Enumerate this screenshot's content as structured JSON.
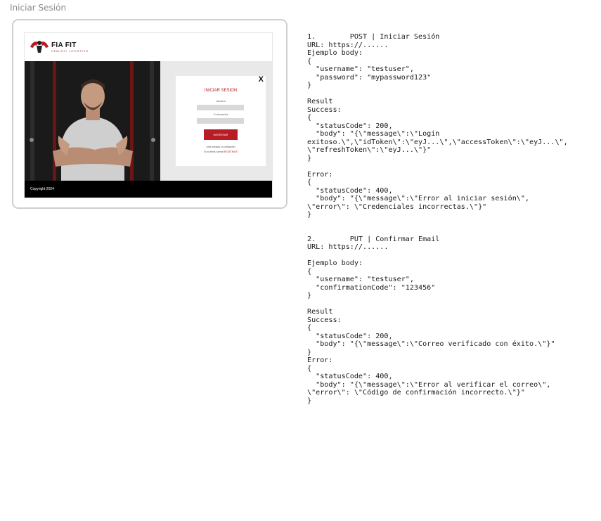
{
  "frame_title": "Iniciar Sesión",
  "mockup": {
    "logo_text": "FIA FIT",
    "logo_subtext": "HEALTHY LIFESTYLE",
    "close_label": "X",
    "card_title": "INICIAR SESION",
    "username_label": "Usuario",
    "password_label": "Contraseña",
    "submit_label": "INGRESAR",
    "forgot_text": "¿Has olvidado tu contraseña?",
    "signup_prefix": "Si no tienes cuenta",
    "signup_link": "REGISTRATE",
    "copyright": "Copyright 2024"
  },
  "doc_lines": [
    "1.        POST | Iniciar Sesión",
    "URL: https://......",
    "Ejemplo body:",
    "{",
    "  \"username\": \"testuser\",",
    "  \"password\": \"mypassword123\"",
    "}",
    "",
    "Result",
    "Success:",
    "{",
    "  \"statusCode\": 200,",
    "  \"body\": \"{\\\"message\\\":\\\"Login",
    "exitoso.\\\",\\\"idToken\\\":\\\"eyJ...\\\",\\\"accessToken\\\":\\\"eyJ...\\\",",
    "\\\"refreshToken\\\":\\\"eyJ...\\\"}\"",
    "}",
    "",
    "Error:",
    "{",
    "  \"statusCode\": 400,",
    "  \"body\": \"{\\\"message\\\":\\\"Error al iniciar sesión\\\",",
    "\\\"error\\\": \\\"Credenciales incorrectas.\\\"}\"",
    "}",
    "",
    "",
    "2.        PUT | Confirmar Email",
    "URL: https://......",
    "",
    "Ejemplo body:",
    "{",
    "  \"username\": \"testuser\",",
    "  \"confirmationCode\": \"123456\"",
    "}",
    "",
    "Result",
    "Success:",
    "{",
    "  \"statusCode\": 200,",
    "  \"body\": \"{\\\"message\\\":\\\"Correo verificado con éxito.\\\"}\"",
    "}",
    "Error:",
    "{",
    "  \"statusCode\": 400,",
    "  \"body\": \"{\\\"message\\\":\\\"Error al verificar el correo\\\",",
    "\\\"error\\\": \\\"Código de confirmación incorrecto.\\\"}\"",
    "}"
  ],
  "colors": {
    "brand_red": "#b81c24",
    "footer_black": "#000000",
    "frame_border": "#cfcfcf"
  }
}
